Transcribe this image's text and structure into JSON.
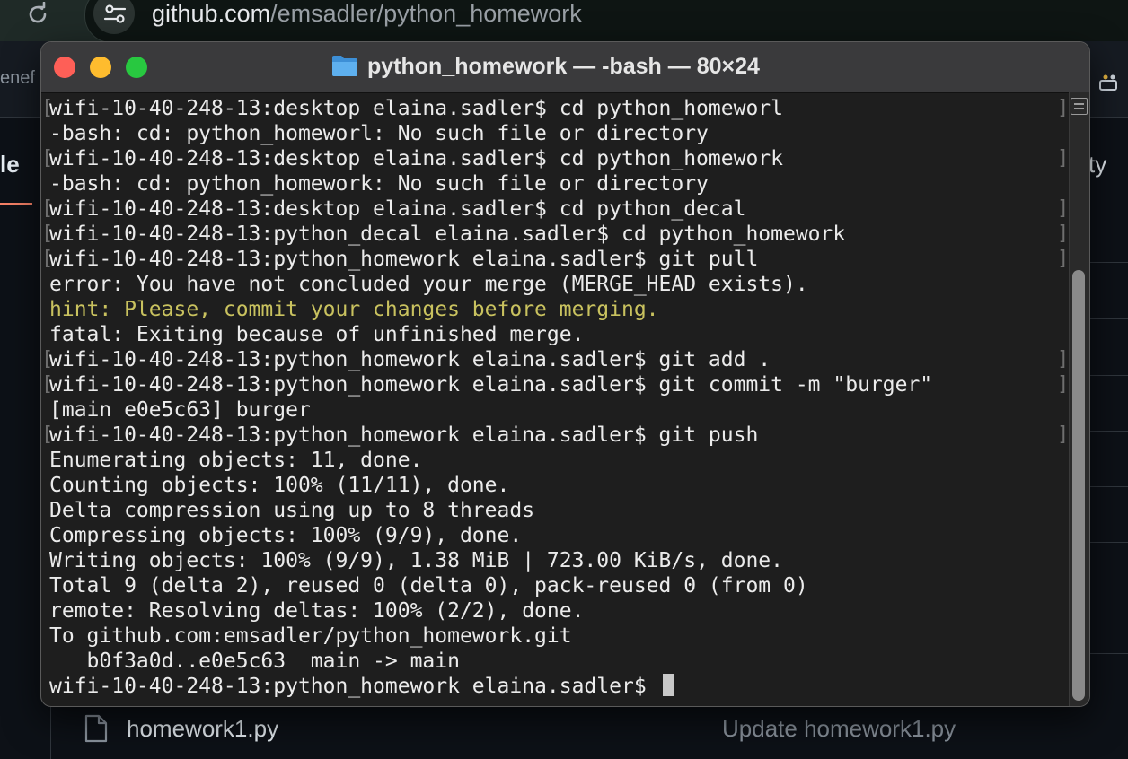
{
  "browser": {
    "url_host": "github.com",
    "url_path": "/emsadler/python_homework",
    "left_edge_word": "enef",
    "nav_left_fragment": "le",
    "nav_right_fragment": "ty",
    "file_row": {
      "file_name": "homework1.py",
      "commit_message": "Update homework1.py"
    },
    "icons": [
      "reload-icon",
      "tune-icon",
      "extension-icon",
      "file-icon"
    ],
    "colors": {
      "underline": "#f78166"
    }
  },
  "terminal": {
    "title": "python_homework — -bash — 80×24",
    "title_icon": "folder-icon",
    "lines": [
      {
        "text": "wifi-10-40-248-13:desktop elaina.sadler$ cd python_homeworl",
        "mark": true
      },
      {
        "text": "-bash: cd: python_homeworl: No such file or directory",
        "mark": false
      },
      {
        "text": "wifi-10-40-248-13:desktop elaina.sadler$ cd python_homework",
        "mark": true
      },
      {
        "text": "-bash: cd: python_homework: No such file or directory",
        "mark": false
      },
      {
        "text": "wifi-10-40-248-13:desktop elaina.sadler$ cd python_decal",
        "mark": true
      },
      {
        "text": "wifi-10-40-248-13:python_decal elaina.sadler$ cd python_homework",
        "mark": true
      },
      {
        "text": "wifi-10-40-248-13:python_homework elaina.sadler$ git pull",
        "mark": true
      },
      {
        "text": "error: You have not concluded your merge (MERGE_HEAD exists).",
        "mark": false
      },
      {
        "text": "hint: Please, commit your changes before merging.",
        "mark": false,
        "style": "hint"
      },
      {
        "text": "fatal: Exiting because of unfinished merge.",
        "mark": false
      },
      {
        "text": "wifi-10-40-248-13:python_homework elaina.sadler$ git add .",
        "mark": true
      },
      {
        "text": "wifi-10-40-248-13:python_homework elaina.sadler$ git commit -m \"burger\"",
        "mark": true
      },
      {
        "text": "[main e0e5c63] burger",
        "mark": false
      },
      {
        "text": "wifi-10-40-248-13:python_homework elaina.sadler$ git push",
        "mark": true
      },
      {
        "text": "Enumerating objects: 11, done.",
        "mark": false
      },
      {
        "text": "Counting objects: 100% (11/11), done.",
        "mark": false
      },
      {
        "text": "Delta compression using up to 8 threads",
        "mark": false
      },
      {
        "text": "Compressing objects: 100% (9/9), done.",
        "mark": false
      },
      {
        "text": "Writing objects: 100% (9/9), 1.38 MiB | 723.00 KiB/s, done.",
        "mark": false
      },
      {
        "text": "Total 9 (delta 2), reused 0 (delta 0), pack-reused 0 (from 0)",
        "mark": false
      },
      {
        "text": "remote: Resolving deltas: 100% (2/2), done.",
        "mark": false
      },
      {
        "text": "To github.com:emsadler/python_homework.git",
        "mark": false
      },
      {
        "text": "   b0f3a0d..e0e5c63  main -> main",
        "mark": false
      },
      {
        "text": "wifi-10-40-248-13:python_homework elaina.sadler$ ",
        "mark": false,
        "cursor": true
      }
    ],
    "colors": {
      "background": "#1e1e1e",
      "text": "#ebebeb",
      "hint": "#c9c25f",
      "close": "#fe5f57",
      "minimize": "#febc2e",
      "maximize": "#28c840"
    }
  }
}
